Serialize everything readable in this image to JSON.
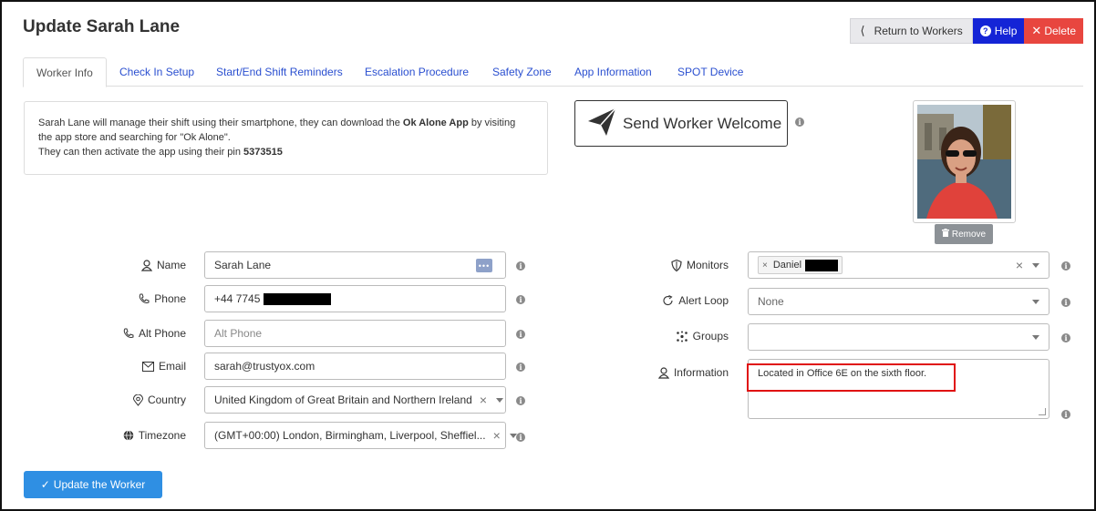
{
  "header": {
    "title": "Update Sarah Lane",
    "return_label": "Return to Workers",
    "help_label": "Help",
    "delete_label": "Delete"
  },
  "tabs": [
    {
      "label": "Worker Info",
      "active": true
    },
    {
      "label": "Check In Setup"
    },
    {
      "label": "Start/End Shift Reminders"
    },
    {
      "label": "Escalation Procedure"
    },
    {
      "label": "Safety Zone"
    },
    {
      "label": "App Information"
    },
    {
      "label": "SPOT Device"
    }
  ],
  "info": {
    "line1_pre": "Sarah Lane will manage their shift using their smartphone, they can download the ",
    "line1_app": "Ok Alone App",
    "line1_post": " by visiting",
    "line2": "the app store and searching for \"Ok Alone\".",
    "line3_pre": "They can then activate the app using their pin ",
    "pin": "5373515"
  },
  "welcome": {
    "label": "Send Worker Welcome"
  },
  "photo": {
    "remove_label": "Remove"
  },
  "fields_left": {
    "name": {
      "label": "Name",
      "value": "Sarah Lane"
    },
    "phone": {
      "label": "Phone",
      "value": "+44 7745"
    },
    "alt_phone": {
      "label": "Alt Phone",
      "placeholder": "Alt Phone"
    },
    "email": {
      "label": "Email",
      "value": "sarah@trustyox.com"
    },
    "country": {
      "label": "Country",
      "value": "United Kingdom of Great Britain and Northern Ireland"
    },
    "timezone": {
      "label": "Timezone",
      "value": "(GMT+00:00) London, Birmingham, Liverpool, Sheffiel..."
    }
  },
  "fields_right": {
    "monitors": {
      "label": "Monitors",
      "tag": "Daniel"
    },
    "alert_loop": {
      "label": "Alert Loop",
      "value": "None"
    },
    "groups": {
      "label": "Groups",
      "value": ""
    },
    "information": {
      "label": "Information",
      "value": "Located in Office 6E on the sixth floor."
    }
  },
  "submit": {
    "label": "Update the Worker"
  },
  "colors": {
    "help": "#1424d6",
    "delete": "#e8463f",
    "submit": "#2f8fe3",
    "link": "#2a4fd0",
    "highlight": "#e01010"
  }
}
